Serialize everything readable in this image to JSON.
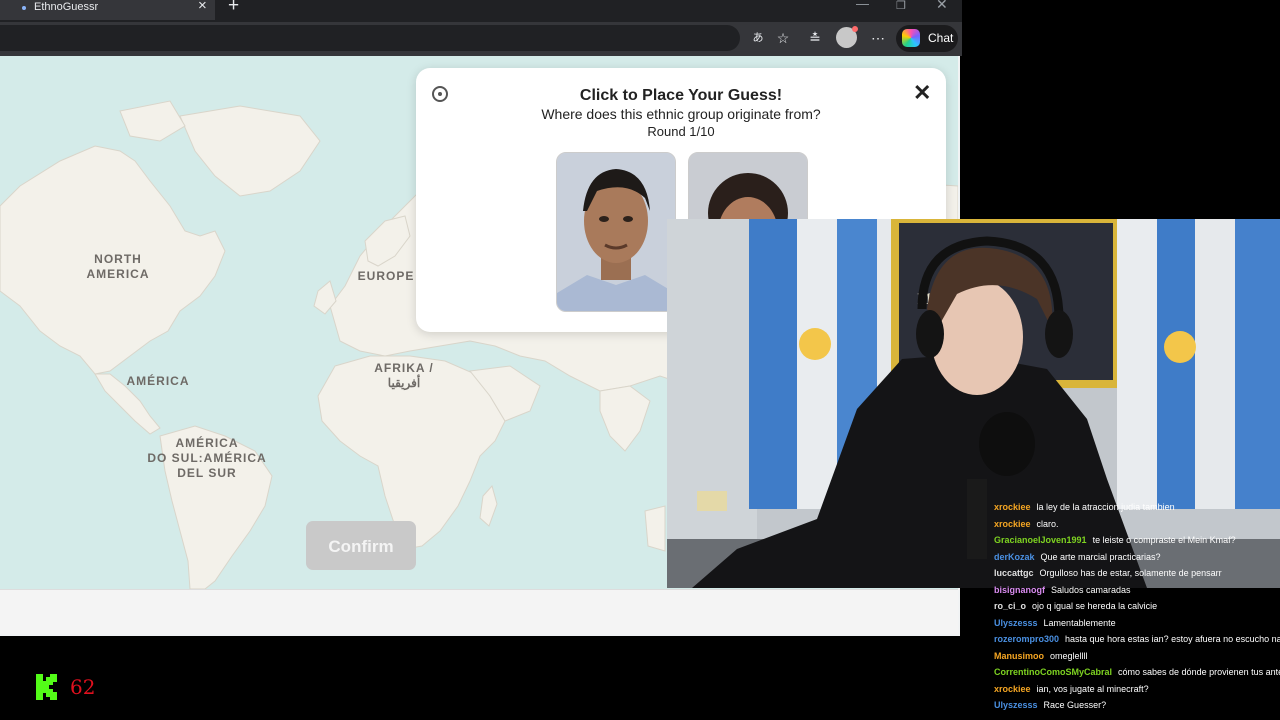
{
  "browser": {
    "tab_title": "EthnoGuessr",
    "chat_label": "Chat"
  },
  "map": {
    "labels": {
      "north_america": "NORTH\nAMERICA",
      "america": "AMÉRICA",
      "south_america": "AMÉRICA\nDO SUL:AMÉRICA\nDEL SUR",
      "europe": "EUROPE",
      "africa": "AFRIKA /\nأفريقيا"
    },
    "confirm_label": "Confirm"
  },
  "panel": {
    "title": "Click to Place Your Guess!",
    "subtitle": "Where does this ethnic group originate from?",
    "round": "Round 1/10"
  },
  "stream": {
    "banner_text": "MIT           NS",
    "viewer_count": "62"
  },
  "chat": {
    "messages": [
      {
        "user": "xrockiee",
        "color": "#f5a623",
        "text": "la ley de la atraccion judia tambien"
      },
      {
        "user": "xrockiee",
        "color": "#f5a623",
        "text": "claro."
      },
      {
        "user": "GracianoelJoven1991",
        "color": "#7ed321",
        "text": "te leiste o compraste el Mein Kmaf?"
      },
      {
        "user": "derKozak",
        "color": "#4a90e2",
        "text": "Que arte marcial practicarias?"
      },
      {
        "user": "luccattgc",
        "color": "#e0e0e0",
        "text": "Orgulloso has de estar, solamente de pensarr"
      },
      {
        "user": "bisignanogf",
        "color": "#d98cf0",
        "text": "Saludos camaradas"
      },
      {
        "user": "ro_ci_o",
        "color": "#e0e0e0",
        "text": "ojo q igual se hereda la calvicie"
      },
      {
        "user": "Ulyszesss",
        "color": "#4a90e2",
        "text": "Lamentablemente"
      },
      {
        "user": "rozerompro300",
        "color": "#4a90e2",
        "text": "hasta que hora estas ian? estoy afuera no escucho nada"
      },
      {
        "user": "Manusimoo",
        "color": "#f5a623",
        "text": "omeglellll"
      },
      {
        "user": "CorrentinoComoSMyCabral",
        "color": "#7ed321",
        "text": "cómo sabes de dónde provienen tus antepasados"
      },
      {
        "user": "xrockiee",
        "color": "#f5a623",
        "text": "ian, vos jugate al minecraft?"
      },
      {
        "user": "Ulyszesss",
        "color": "#4a90e2",
        "text": "Race Guesser?"
      }
    ]
  }
}
